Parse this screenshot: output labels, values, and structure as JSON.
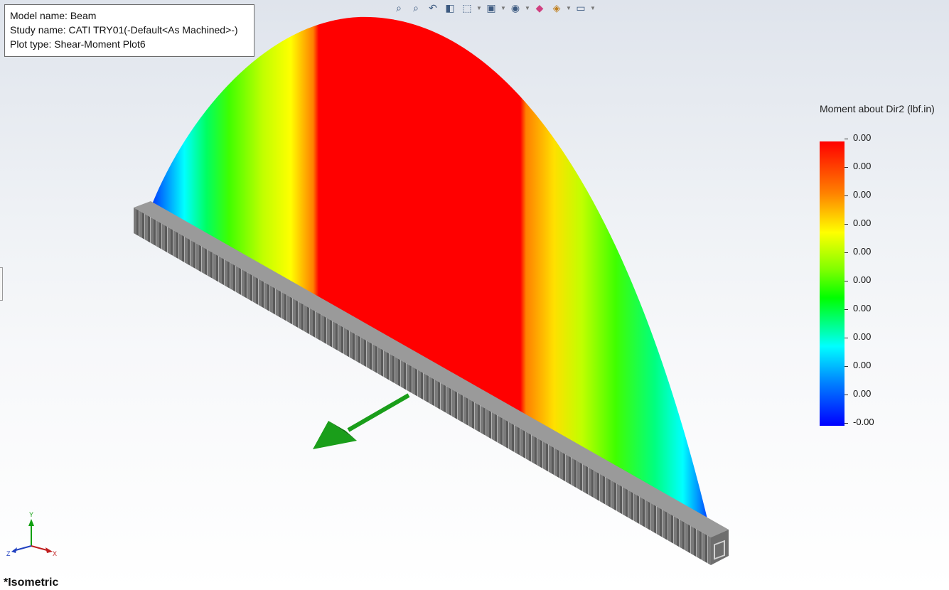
{
  "info": {
    "model_label": "Model name: Beam",
    "study_label": "Study name: CATI TRY01(-Default<As Machined>-)",
    "plot_label": "Plot type:  Shear-Moment Plot6"
  },
  "toolbar": {
    "items": [
      {
        "name": "zoom-to-fit-icon",
        "glyph": "⌕"
      },
      {
        "name": "zoom-to-area-icon",
        "glyph": "⌕"
      },
      {
        "name": "previous-view-icon",
        "glyph": "↶"
      },
      {
        "name": "section-view-icon",
        "glyph": "◧"
      },
      {
        "name": "view-orientation-icon",
        "glyph": "⬚"
      },
      {
        "name": "display-style-icon",
        "glyph": "▣"
      },
      {
        "name": "hide-show-icon",
        "glyph": "◉"
      },
      {
        "name": "edit-appearance-icon",
        "glyph": "◆"
      },
      {
        "name": "apply-scene-icon",
        "glyph": "◈"
      },
      {
        "name": "view-settings-icon",
        "glyph": "▭"
      }
    ]
  },
  "legend": {
    "title": "Moment about Dir2 (lbf.in)",
    "labels": [
      "0.00",
      "0.00",
      "0.00",
      "0.00",
      "0.00",
      "0.00",
      "0.00",
      "0.00",
      "0.00",
      "0.00",
      "-0.00"
    ],
    "colors": {
      "max": "#ff0000",
      "min": "#0000ff"
    }
  },
  "triad": {
    "x": "X",
    "y": "Y",
    "z": "Z"
  },
  "view_name": "*Isometric"
}
